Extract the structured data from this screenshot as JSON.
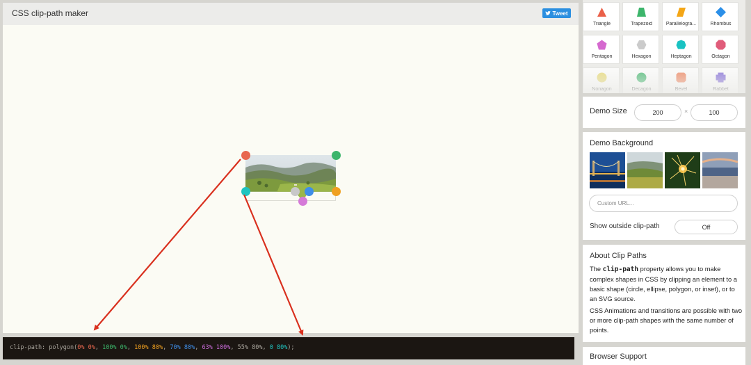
{
  "header": {
    "title": "CSS clip-path maker",
    "tweet_label": "Tweet"
  },
  "code_bar": {
    "prefix": "clip-path: polygon(",
    "points": [
      {
        "text": "0% 0%",
        "color": "#e8674f"
      },
      {
        "text": "100% 0%",
        "color": "#3cb56b"
      },
      {
        "text": "100% 80%",
        "color": "#f0a020"
      },
      {
        "text": "70% 80%",
        "color": "#3f8ee8"
      },
      {
        "text": "63% 100%",
        "color": "#c86bd8"
      },
      {
        "text": "55% 80%",
        "color": "#a8a49c"
      },
      {
        "text": "0 80%",
        "color": "#20c4c0"
      }
    ],
    "suffix": ");"
  },
  "handles": [
    {
      "name": "handle-top-left",
      "color": "#e8674f"
    },
    {
      "name": "handle-top-right",
      "color": "#3cb56b"
    },
    {
      "name": "handle-right",
      "color": "#f0a020"
    },
    {
      "name": "handle-inner-right",
      "color": "#3f8ee8"
    },
    {
      "name": "handle-bottom",
      "color": "#d57ad8"
    },
    {
      "name": "handle-inner-left",
      "color": "#c8c8c8"
    },
    {
      "name": "handle-left",
      "color": "#20c4c0"
    }
  ],
  "shapes": [
    {
      "label": "Triangle",
      "icon": "triangle-icon",
      "color": "#ea6049"
    },
    {
      "label": "Trapezoid",
      "icon": "trapezoid-icon",
      "color": "#3cb56b"
    },
    {
      "label": "Parallelogra...",
      "icon": "parallelogram-icon",
      "color": "#f4a616"
    },
    {
      "label": "Rhombus",
      "icon": "rhombus-icon",
      "color": "#2b8fe8"
    },
    {
      "label": "Pentagon",
      "icon": "pentagon-icon",
      "color": "#d569cf"
    },
    {
      "label": "Hexagon",
      "icon": "hexagon-icon",
      "color": "#cbcbcb"
    },
    {
      "label": "Heptagon",
      "icon": "heptagon-icon",
      "color": "#19c2c2"
    },
    {
      "label": "Octagon",
      "icon": "octagon-icon",
      "color": "#e05c7a"
    },
    {
      "label": "Nonagon",
      "icon": "nonagon-icon",
      "color": "#e8d96e"
    },
    {
      "label": "Decagon",
      "icon": "decagon-icon",
      "color": "#3cb56b"
    },
    {
      "label": "Bevel",
      "icon": "bevel-icon",
      "color": "#f07e56"
    },
    {
      "label": "Rabbet",
      "icon": "rabbet-icon",
      "color": "#7b63d8"
    }
  ],
  "demo_size": {
    "label": "Demo Size",
    "width": "200",
    "separator": "×",
    "height": "100"
  },
  "demo_background": {
    "title": "Demo Background",
    "thumbnails": [
      "bridge-night-thumb",
      "countryside-thumb",
      "sparkler-thumb",
      "beach-thumb"
    ],
    "custom_url_placeholder": "Custom URL...",
    "outside_label": "Show outside clip-path",
    "outside_value": "Off"
  },
  "about": {
    "title": "About Clip Paths",
    "p1_before": "The ",
    "p1_code": "clip-path",
    "p1_after": " property allows you to make complex shapes in CSS by clipping an element to a basic shape (circle, ellipse, polygon, or inset), or to an SVG source.",
    "p2": "CSS Animations and transitions are possible with two or more clip-path shapes with the same number of points."
  },
  "support": {
    "title": "Browser Support"
  },
  "colors": {
    "arrow": "#d9301e",
    "code_bg": "#1b1612",
    "tweet": "#2b8fe0"
  }
}
